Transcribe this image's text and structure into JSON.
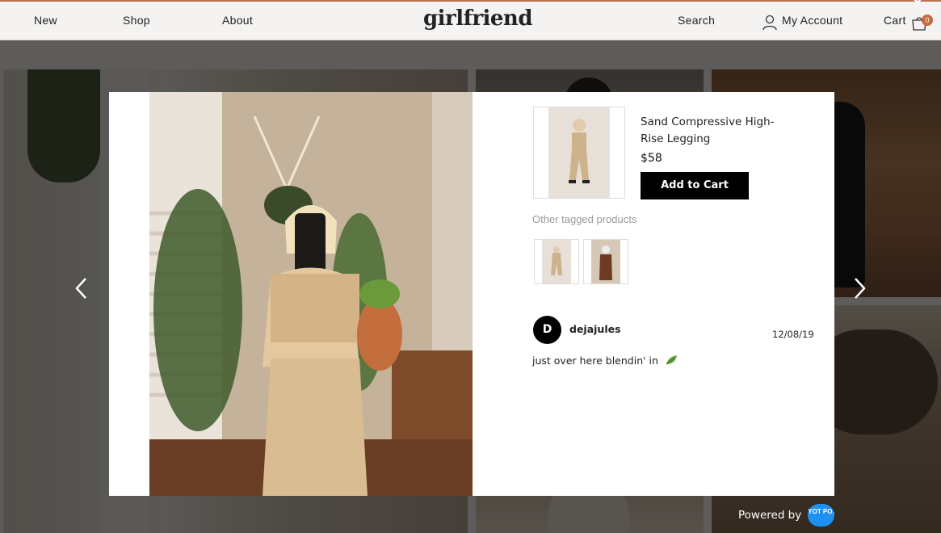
{
  "header": {
    "nav": [
      "New",
      "Shop",
      "About"
    ],
    "logo": "girlfriend",
    "search": "Search",
    "account": "My Account",
    "cart": "Cart",
    "cart_count": "0"
  },
  "product": {
    "name": "Sand Compressive High-Rise Legging",
    "price": "$58",
    "add_to_cart": "Add to Cart"
  },
  "other_tagged_label": "Other tagged products",
  "post": {
    "avatar_initial": "D",
    "username": "dejajules",
    "date": "12/08/19",
    "caption": "just over here blendin' in"
  },
  "footer": {
    "powered_by": "Powered by",
    "brand": "YOT PO."
  },
  "colors": {
    "accent": "#c8693f",
    "button": "#000000",
    "yotpo": "#1f8ff0"
  }
}
